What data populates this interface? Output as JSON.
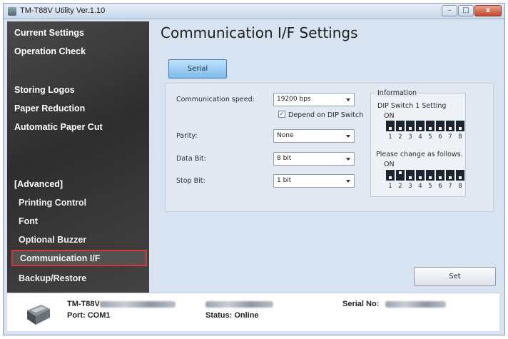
{
  "window": {
    "title": "TM-T88V Utility Ver.1.10",
    "controls": {
      "minimize": "–",
      "maximize": "□",
      "close": "x"
    }
  },
  "sidebar": {
    "items": [
      {
        "label": "Current Settings"
      },
      {
        "label": "Operation Check"
      },
      {
        "label": "Storing Logos"
      },
      {
        "label": "Paper Reduction"
      },
      {
        "label": "Automatic Paper Cut"
      },
      {
        "label": "[Advanced]"
      },
      {
        "label": "Printing Control"
      },
      {
        "label": "Font"
      },
      {
        "label": "Optional Buzzer"
      },
      {
        "label": "Communication I/F",
        "selected": true
      },
      {
        "label": "Backup/Restore"
      }
    ]
  },
  "main": {
    "title": "Communication I/F Settings",
    "tab": "Serial",
    "fields": {
      "speed_label": "Communication speed:",
      "speed_value": "19200 bps",
      "depend_label": "Depend on DIP Switch",
      "depend_checked": true,
      "parity_label": "Parity:",
      "parity_value": "None",
      "databit_label": "Data Bit:",
      "databit_value": "8 bit",
      "stopbit_label": "Stop Bit:",
      "stopbit_value": "1 bit"
    },
    "information": {
      "heading": "Information",
      "dip_setting_label": "DIP Switch 1 Setting",
      "on_label_1": "ON",
      "change_label": "Please change as follows.",
      "on_label_2": "ON",
      "switch_numbers": [
        "1",
        "2",
        "3",
        "4",
        "5",
        "6",
        "7",
        "8"
      ],
      "current_states": [
        "off",
        "off",
        "off",
        "off",
        "off",
        "off",
        "off",
        "off"
      ],
      "target_states": [
        "off",
        "on",
        "off",
        "off",
        "off",
        "off",
        "off",
        "off"
      ]
    },
    "set_button": "Set"
  },
  "footer": {
    "model": "TM-T88V",
    "port": "Port: COM1",
    "status": "Status: Online",
    "serial_label": "Serial No:"
  },
  "icons": {
    "app": "printer-app-icon",
    "printer": "printer-icon"
  },
  "colors": {
    "sidebar_bg": "#3a3a3a",
    "selected_outline": "#d13a3a",
    "tab_active": "#7fbbe9"
  }
}
